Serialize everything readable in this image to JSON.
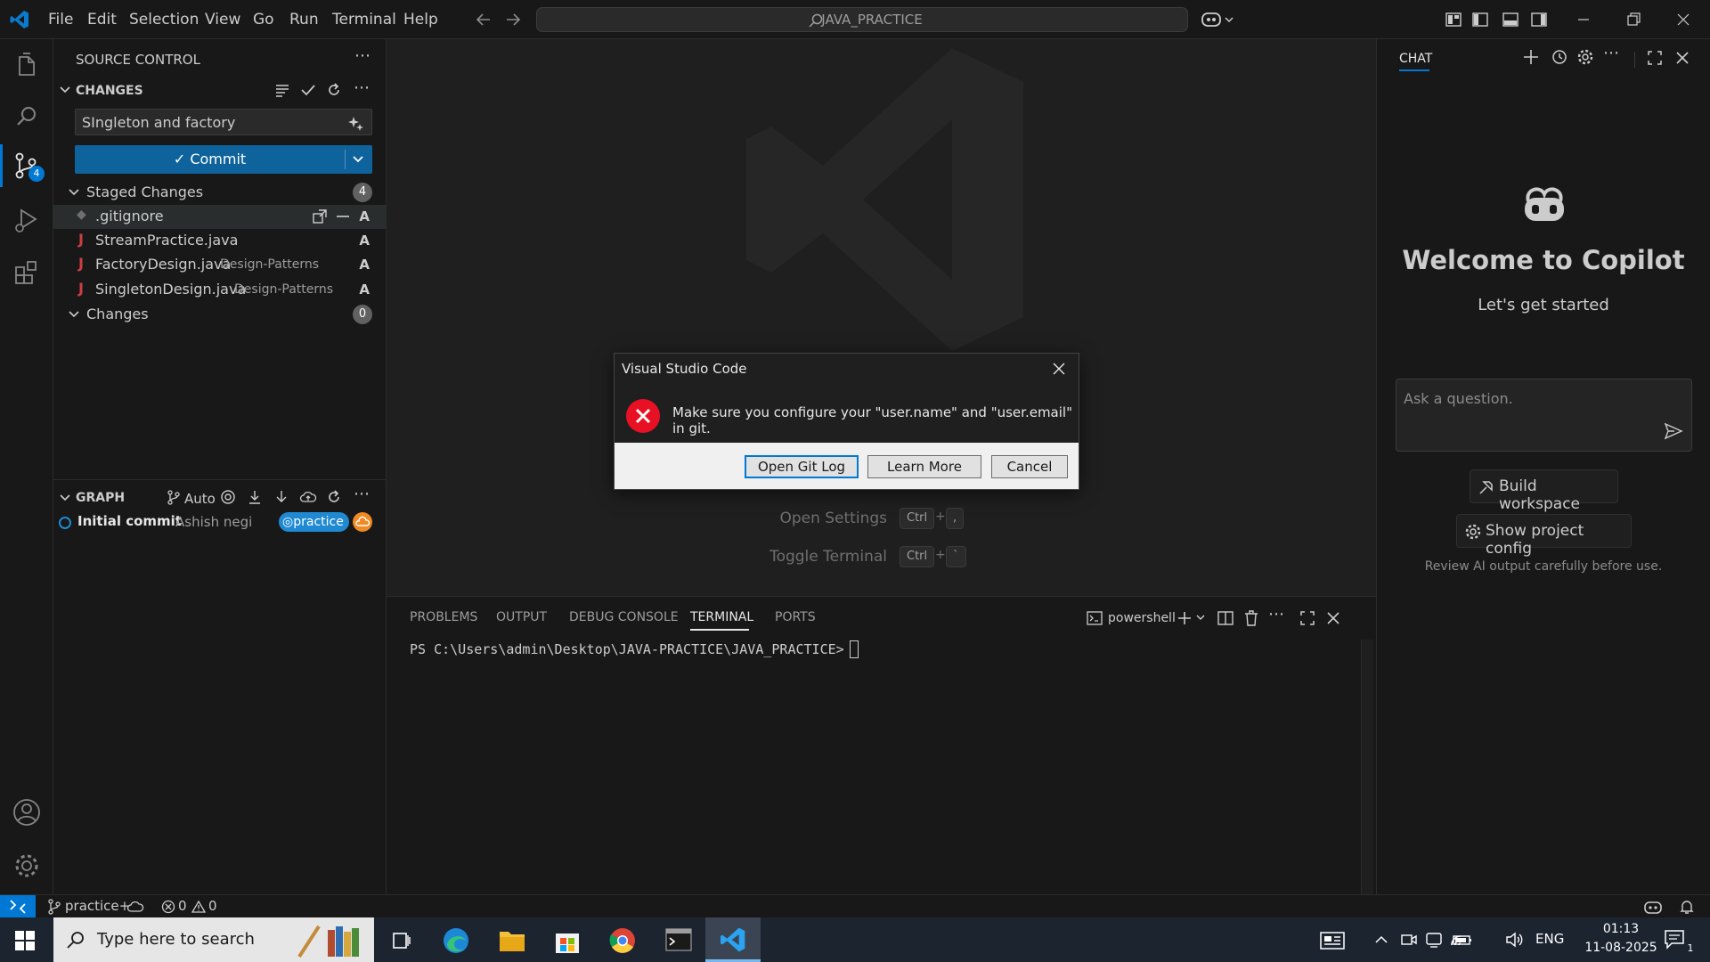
{
  "colors": {
    "accent": "#0078d4",
    "commit_button": "#0e639c",
    "error": "#e81123",
    "branch_badge": "#1f8ad2",
    "cloud_badge": "#f08a24",
    "java_icon": "#cc3e44"
  },
  "titlebar": {
    "menu": [
      "File",
      "Edit",
      "Selection",
      "View",
      "Go",
      "Run",
      "Terminal",
      "Help"
    ],
    "search_text": "JAVA_PRACTICE"
  },
  "activitybar": {
    "scm_badge": "4"
  },
  "sidebar": {
    "title": "SOURCE CONTROL",
    "changes_header": "CHANGES",
    "commit_message": "SIngleton and factory",
    "commit_button": "Commit",
    "staged": {
      "label": "Staged Changes",
      "count": "4",
      "files": [
        {
          "name": ".gitignore",
          "path": "",
          "status": "A"
        },
        {
          "name": "StreamPractice.java",
          "path": "",
          "status": "A"
        },
        {
          "name": "FactoryDesign.java",
          "path": "Design-Patterns",
          "status": "A"
        },
        {
          "name": "SingletonDesign.java",
          "path": "Design-Patterns",
          "status": "A"
        }
      ]
    },
    "changes": {
      "label": "Changes",
      "count": "0"
    },
    "graph": {
      "header": "GRAPH",
      "auto_label": "Auto",
      "commit_title": "Initial commit",
      "commit_author": "Ashish negi",
      "branch": "practice"
    }
  },
  "editor": {
    "hints": [
      {
        "label": "Open Settings",
        "keys": [
          "Ctrl",
          "+",
          ","
        ]
      },
      {
        "label": "Toggle Terminal",
        "keys": [
          "Ctrl",
          "+",
          "`"
        ]
      }
    ]
  },
  "dialog": {
    "title": "Visual Studio Code",
    "message": "Make sure you configure your \"user.name\" and \"user.email\" in git.",
    "buttons": {
      "open_git_log": "Open Git Log",
      "learn_more": "Learn More",
      "cancel": "Cancel"
    }
  },
  "panel": {
    "tabs": [
      "PROBLEMS",
      "OUTPUT",
      "DEBUG CONSOLE",
      "TERMINAL",
      "PORTS"
    ],
    "active_tab": "TERMINAL",
    "shell": "powershell",
    "prompt": "PS C:\\Users\\admin\\Desktop\\JAVA-PRACTICE\\JAVA_PRACTICE>"
  },
  "chat": {
    "title": "CHAT",
    "welcome": "Welcome to Copilot",
    "subtitle": "Let's get started",
    "input_placeholder": "Ask a question.",
    "build_workspace": "Build workspace",
    "show_config": "Show project config",
    "disclaimer": "Review AI output carefully before use."
  },
  "statusbar": {
    "branch": "practice+",
    "errors": "0",
    "warnings": "0"
  },
  "taskbar": {
    "search_placeholder": "Type here to search",
    "language": "ENG",
    "time": "01:13",
    "date": "11-08-2025",
    "notification_count": "1"
  }
}
